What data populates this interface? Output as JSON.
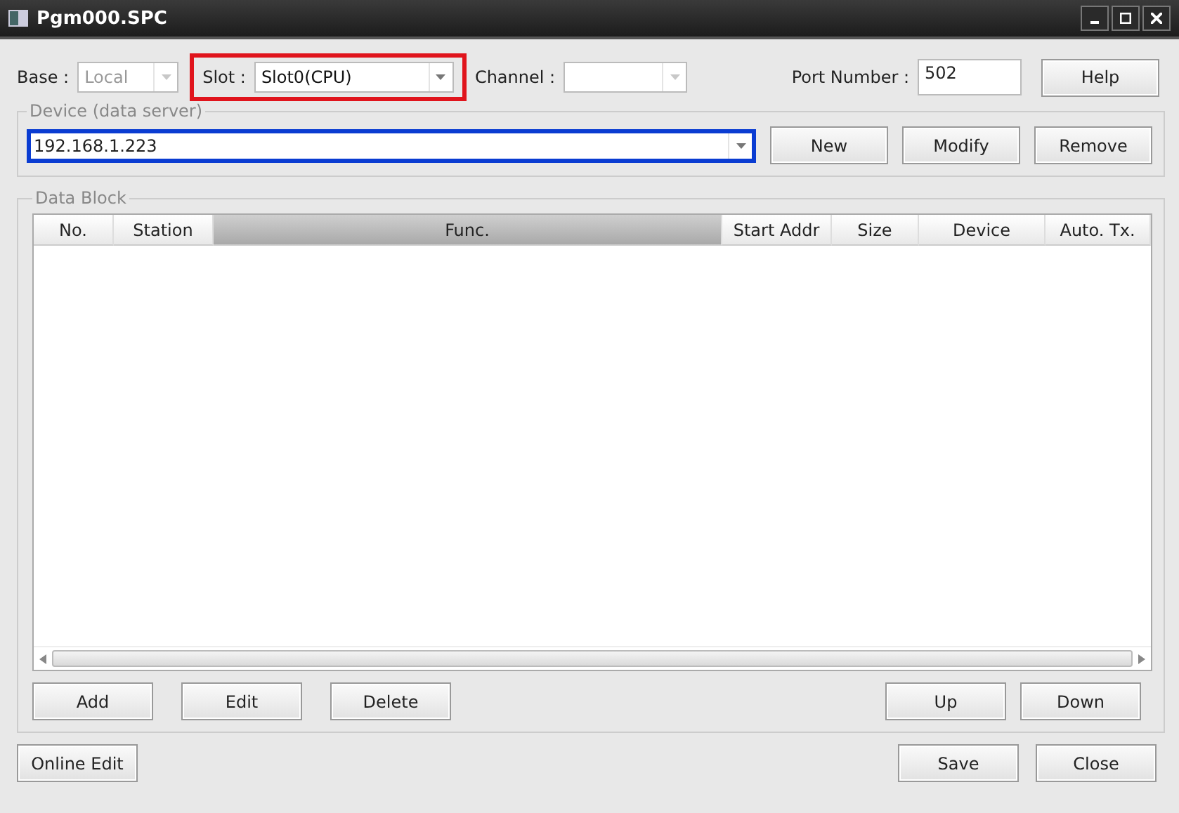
{
  "window": {
    "title": "Pgm000.SPC"
  },
  "base": {
    "label": "Base :",
    "value": "Local",
    "disabled": true
  },
  "slot": {
    "label": "Slot :",
    "value": "Slot0(CPU)",
    "disabled": false,
    "highlighted": true
  },
  "channel": {
    "label": "Channel :",
    "disabled": true
  },
  "port": {
    "label": "Port Number :",
    "value": "502"
  },
  "help_button": "Help",
  "device_group": {
    "title": "Device (data server)",
    "value": "192.168.1.223",
    "highlighted": true,
    "buttons": [
      "New",
      "Modify",
      "Remove"
    ]
  },
  "data_block": {
    "title": "Data Block",
    "columns": [
      {
        "label": "No.",
        "selected": false
      },
      {
        "label": "Station",
        "selected": false
      },
      {
        "label": "Func.",
        "selected": true
      },
      {
        "label": "Start Addr",
        "selected": false
      },
      {
        "label": "Size",
        "selected": false
      },
      {
        "label": "Device",
        "selected": false
      },
      {
        "label": "Auto. Tx.",
        "selected": false
      }
    ],
    "left_buttons": [
      "Add",
      "Edit",
      "Delete"
    ],
    "right_buttons": [
      "Up",
      "Down"
    ]
  },
  "footer": {
    "left_buttons": [
      "Online Edit"
    ],
    "right_buttons": [
      "Save",
      "Close"
    ]
  }
}
